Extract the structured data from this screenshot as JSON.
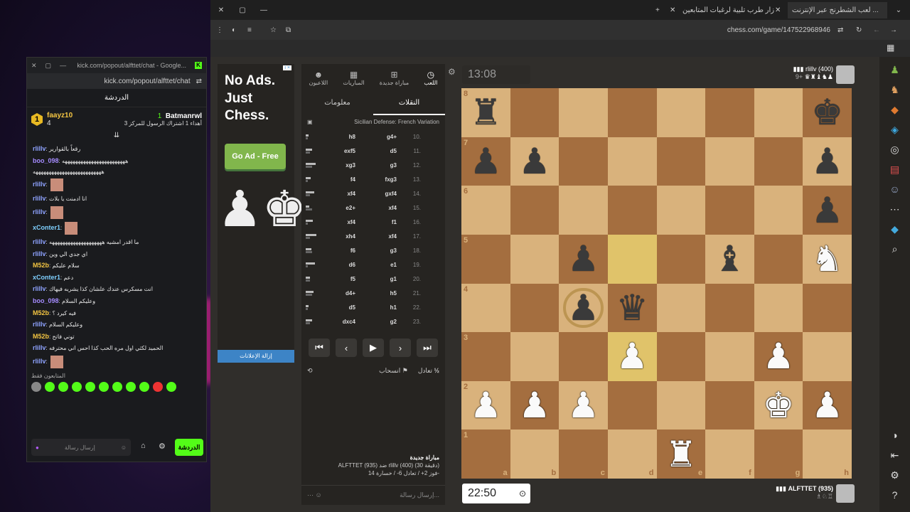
{
  "kick": {
    "window_url": "kick.com/popout/alfttet/chat - Google...",
    "url": "kick.com/popout/alfttet/chat",
    "title": "الدردشة",
    "leader1_name": "faayz10",
    "leader1_count": "4",
    "leader1_rank": "1",
    "leader2_name": "Batmanrwl",
    "leader2_count": "1",
    "leader2_sub": "أهداء 1 اشتراك الرسول للمركز 3",
    "messages": [
      {
        "user": "rlillv",
        "text": "رقعاً بالقوارير",
        "color": "#8fa3ff"
      },
      {
        "user": "boo_098",
        "text": "ههههههههههههههههههههههههه",
        "color": "#a58cff"
      },
      {
        "user": "",
        "text": "ههههههههههههههههههههههههههه",
        "color": "#ccc"
      },
      {
        "user": "rlillv",
        "text": "",
        "color": "#8fa3ff"
      },
      {
        "user": "rlillv",
        "text": "انا ادمنت يا بلات",
        "color": "#8fa3ff"
      },
      {
        "user": "rlillv",
        "text": "",
        "color": "#8fa3ff"
      },
      {
        "user": "xConter1",
        "text": "",
        "color": "#7fd0ff"
      },
      {
        "user": "rlillv",
        "text": "ما اقدر امشيه ههههههههههههههههههههه",
        "color": "#8fa3ff"
      },
      {
        "user": "rlillv",
        "text": "اي جدي الي وين",
        "color": "#8fa3ff"
      },
      {
        "user": "M52b",
        "text": "سلام عليكم",
        "color": "#f4c542"
      },
      {
        "user": "xConter1",
        "text": "دعم",
        "color": "#7fd0ff"
      },
      {
        "user": "rlillv",
        "text": "انت مسكرس عندك علشان كذا يشربه فيهاك",
        "color": "#8fa3ff"
      },
      {
        "user": "boo_098",
        "text": "وعليكم السلام",
        "color": "#a58cff"
      },
      {
        "user": "M52b",
        "text": "فيه كيرد ؟",
        "color": "#f4c542"
      },
      {
        "user": "rlillv",
        "text": "وعليكم السلام",
        "color": "#8fa3ff"
      },
      {
        "user": "M52b",
        "text": "توني فاتح",
        "color": "#f4c542"
      },
      {
        "user": "rlillv",
        "text": "الحميد لكثي اول مره الحب كذا احس اني محترفه",
        "color": "#8fa3ff"
      },
      {
        "user": "rlillv",
        "text": "",
        "color": "#8fa3ff"
      }
    ],
    "followers_only": "المتابعون فقط",
    "input_placeholder": "إرسال رسالة",
    "send_label": "الدردشة"
  },
  "browser": {
    "tab_active": "لعب الشطرنج عبر الإنترنت ...",
    "tab_other": "زار طرب تلبية لرغبات المتابعين",
    "url": "chess.com/game/147522968946"
  },
  "ad": {
    "headline": "No Ads. Just Chess.",
    "button": "Go Ad - Free",
    "footer": "إزالة الإعلانات",
    "badge": "i ×"
  },
  "panel": {
    "tabs": [
      "اللعب",
      "مباراة جديدة",
      "المباريات",
      "اللاعبون"
    ],
    "subtabs": [
      "النقلات",
      "معلومات"
    ],
    "opening": "Sicilian Defense: French Variation",
    "moves": [
      {
        "n": "10.",
        "w": "g4+",
        "b": "h8"
      },
      {
        "n": "11.",
        "w": "d5",
        "b": "exf5"
      },
      {
        "n": "12.",
        "w": "g3",
        "b": "xg3"
      },
      {
        "n": "13.",
        "w": "fxg3",
        "b": "f4"
      },
      {
        "n": "14.",
        "w": "gxf4",
        "b": "xf4"
      },
      {
        "n": "15.",
        "w": "xf4",
        "b": "e2+"
      },
      {
        "n": "16.",
        "w": "f1",
        "b": "xf4"
      },
      {
        "n": "17.",
        "w": "xf4",
        "b": "xh4"
      },
      {
        "n": "18.",
        "w": "g3",
        "b": "f6"
      },
      {
        "n": "19.",
        "w": "e1",
        "b": "d6"
      },
      {
        "n": "20.",
        "w": "g1",
        "b": "f5"
      },
      {
        "n": "21.",
        "w": "h5",
        "b": "d4+"
      },
      {
        "n": "22.",
        "w": "h1",
        "b": "d5"
      },
      {
        "n": "23.",
        "w": "g2",
        "b": "dxc4"
      }
    ],
    "draw": "تعادل",
    "resign": "انسحاب",
    "half": "½",
    "game_title": "مباراة جديدة",
    "game_line": "ALFTTET (935) ضد rlillv (400) (30 دقيقة)",
    "record": "فوز 2+ / تعادل 6- / خسارة 14-",
    "input": "إرسال رسالة..."
  },
  "players": {
    "top_name": "rlillv (400)",
    "top_clock": "13:08",
    "top_captures": "9+",
    "bottom_name": "ALFTTET (935)",
    "bottom_clock": "22:50"
  },
  "board": {
    "ranks": [
      "8",
      "7",
      "6",
      "5",
      "4",
      "3",
      "2",
      "1"
    ],
    "files": [
      "a",
      "b",
      "c",
      "d",
      "e",
      "f",
      "g",
      "h"
    ],
    "position": [
      [
        "bR",
        "",
        "",
        "",
        "",
        "",
        "",
        "bK"
      ],
      [
        "bP",
        "bP",
        "",
        "",
        "",
        "",
        "",
        "bP"
      ],
      [
        "",
        "",
        "",
        "",
        "",
        "",
        "",
        "bP"
      ],
      [
        "",
        "",
        "bP",
        "",
        "",
        "bB",
        "",
        "wN"
      ],
      [
        "",
        "",
        "bP",
        "bQ",
        "",
        "",
        "",
        ""
      ],
      [
        "",
        "",
        "",
        "wP",
        "",
        "",
        "wP",
        ""
      ],
      [
        "wP",
        "wP",
        "wP",
        "",
        "",
        "",
        "wK",
        "wP"
      ],
      [
        "",
        "",
        "",
        "",
        "wR",
        "",
        "",
        ""
      ]
    ],
    "highlights": [
      "d5",
      "d3"
    ]
  }
}
